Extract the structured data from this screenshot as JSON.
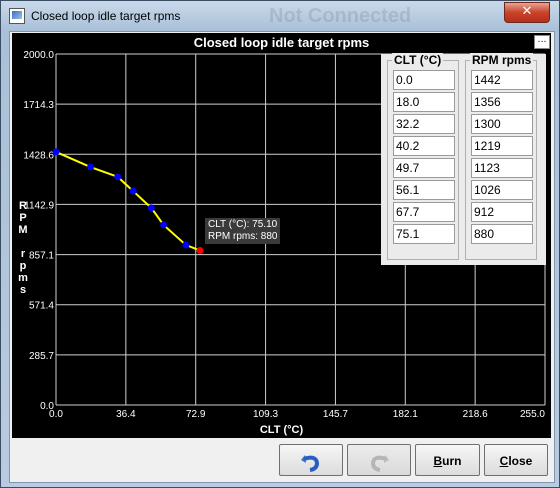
{
  "window": {
    "title": "Closed loop idle target rpms",
    "watermark": "Not Connected",
    "close_glyph": "✕"
  },
  "chart": {
    "title": "Closed loop idle target rpms",
    "menu_glyph": "…",
    "ylabel": "RPM rpms",
    "xlabel": "CLT (°C)"
  },
  "chart_data": {
    "type": "line",
    "title": "Closed loop idle target rpms",
    "xlabel": "CLT (°C)",
    "ylabel": "RPM rpms",
    "xlim": [
      0.0,
      255.0
    ],
    "ylim": [
      0.0,
      2000.0
    ],
    "x_ticks": [
      "0.0",
      "36.4",
      "72.9",
      "109.3",
      "145.7",
      "182.1",
      "218.6",
      "255.0"
    ],
    "y_ticks": [
      "0.0",
      "285.7",
      "571.4",
      "857.1",
      "1142.9",
      "1428.6",
      "1714.3",
      "2000.0"
    ],
    "series": [
      {
        "x": [
          0.0,
          18.0,
          32.2,
          40.2,
          49.7,
          56.1,
          67.7,
          75.1
        ],
        "y": [
          1442,
          1356,
          1300,
          1219,
          1123,
          1026,
          912,
          880
        ],
        "color": "#ffff00",
        "point_color": "#0000ff",
        "selected_color": "#ff0000"
      }
    ],
    "selected_index": 7,
    "grid": true
  },
  "tooltip": {
    "line1": "CLT (°C): 75.10",
    "line2": "RPM rpms: 880"
  },
  "table": {
    "col1_header": "CLT (°C)",
    "col2_header": "RPM rpms",
    "clt": [
      "0.0",
      "18.0",
      "32.2",
      "40.2",
      "49.7",
      "56.1",
      "67.7",
      "75.1"
    ],
    "rpm": [
      "1442",
      "1356",
      "1300",
      "1219",
      "1123",
      "1026",
      "912",
      "880"
    ]
  },
  "buttons": {
    "undo_icon": "undo-icon",
    "redo_icon": "redo-icon",
    "burn_first": "B",
    "burn_rest": "urn",
    "close_first": "C",
    "close_rest": "lose"
  }
}
